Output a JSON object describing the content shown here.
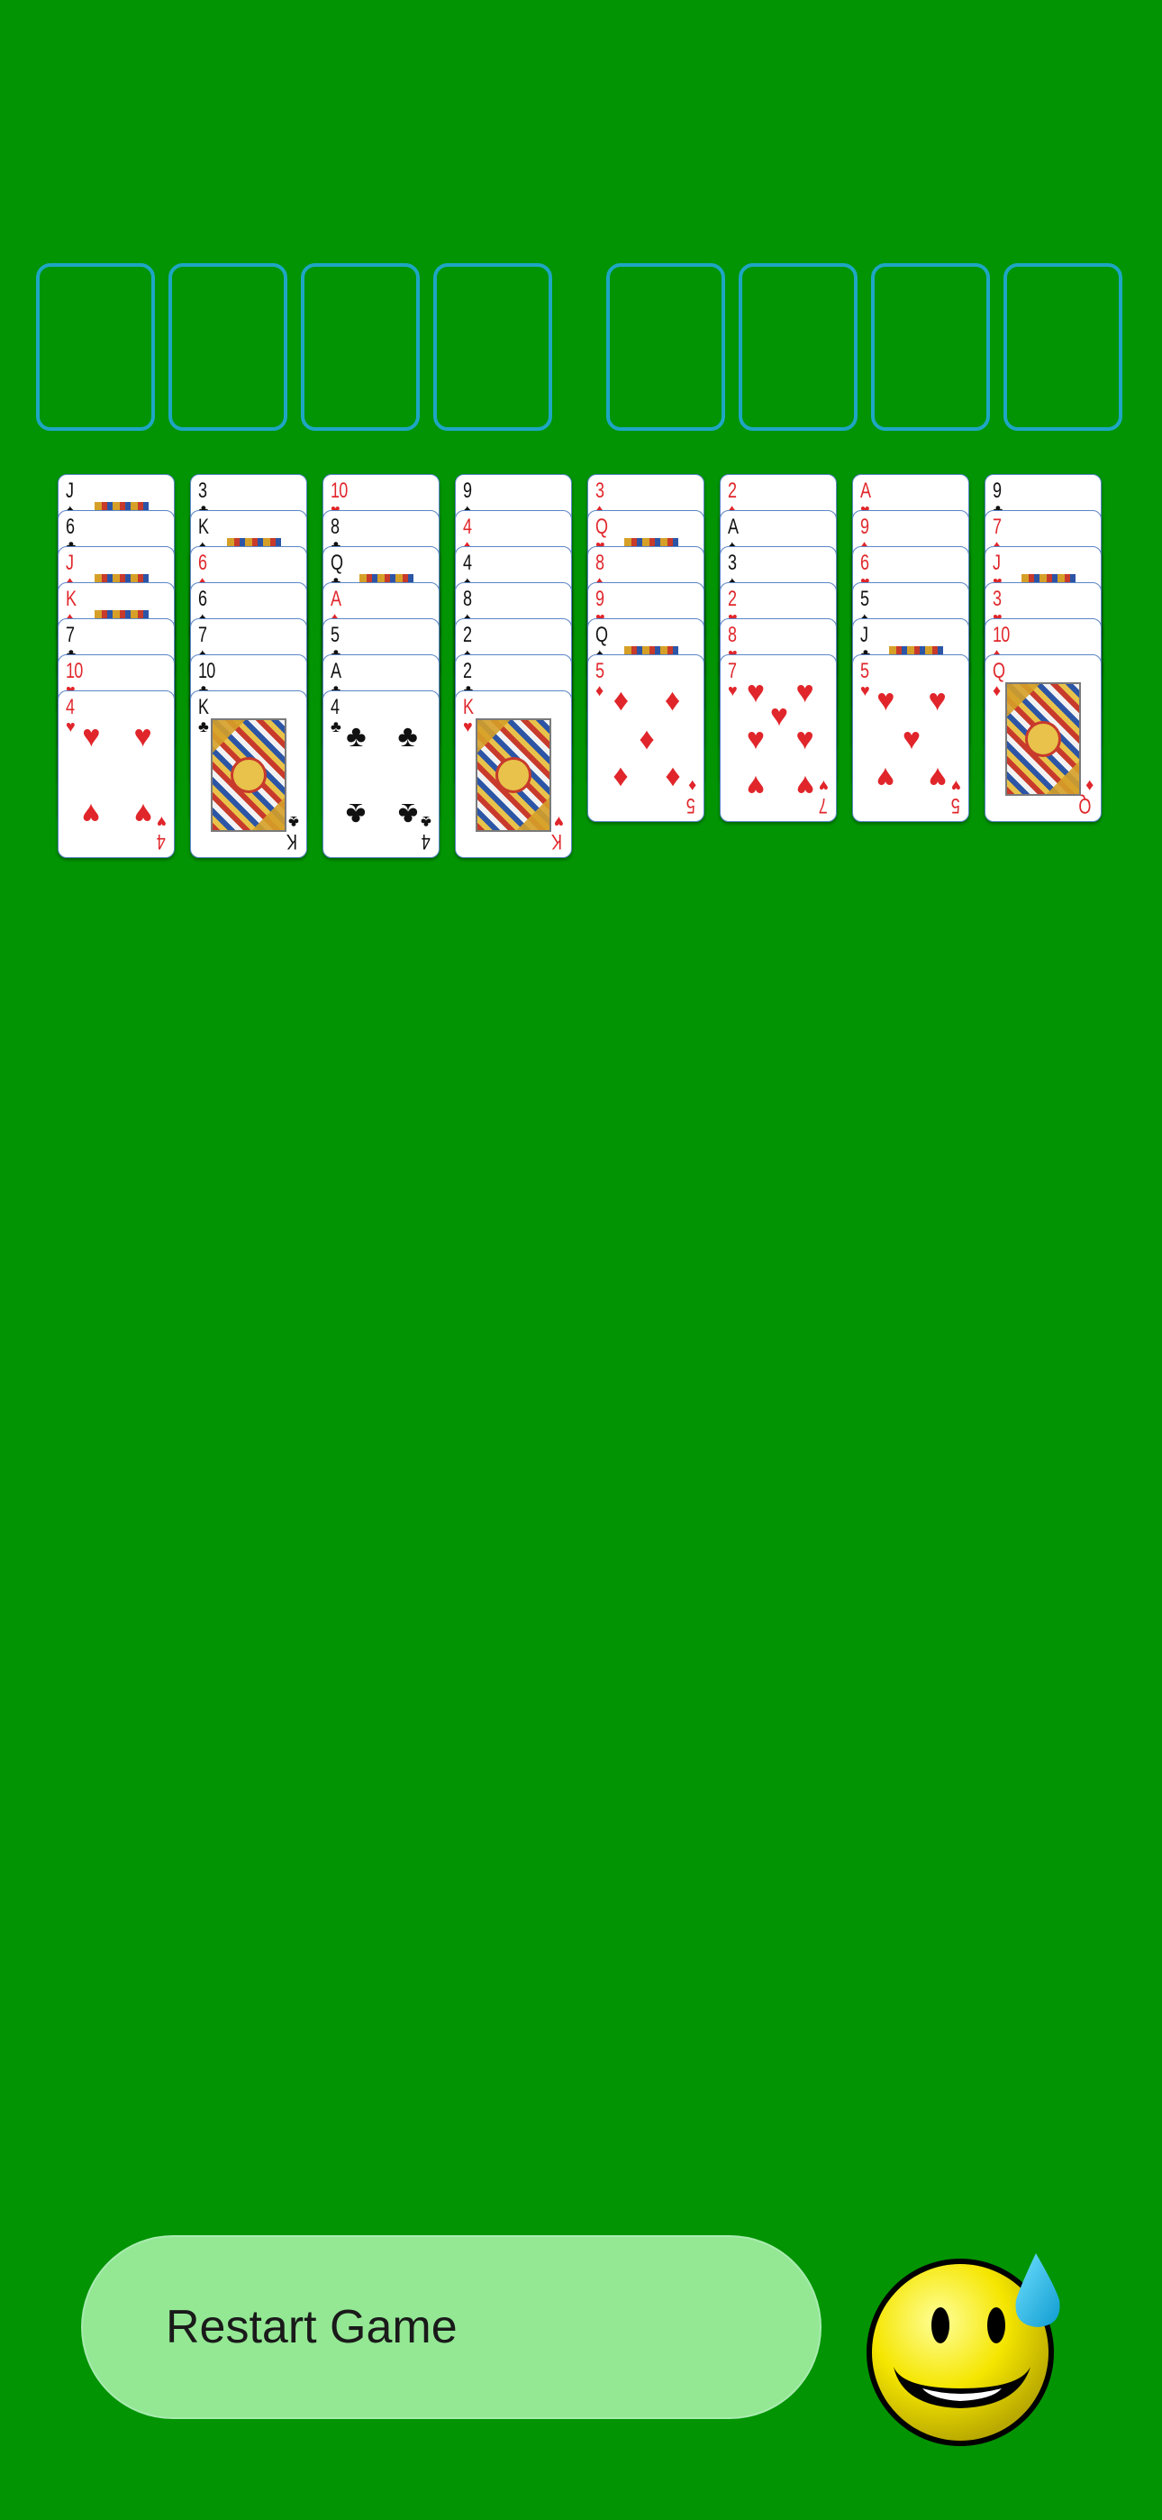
{
  "colors": {
    "felt": "#029402",
    "slot_outline": "#1ea6c4",
    "red_suit": "#e0262b",
    "black_suit": "#111111",
    "restart_fill": "#94e894"
  },
  "foundations": [
    "",
    "",
    "",
    ""
  ],
  "free_cells": [
    "",
    "",
    "",
    ""
  ],
  "tableau": [
    [
      {
        "rank": "J",
        "suit": "♠",
        "color": "black"
      },
      {
        "rank": "6",
        "suit": "♣",
        "color": "black"
      },
      {
        "rank": "J",
        "suit": "♦",
        "color": "red"
      },
      {
        "rank": "K",
        "suit": "♦",
        "color": "red"
      },
      {
        "rank": "7",
        "suit": "♣",
        "color": "black"
      },
      {
        "rank": "10",
        "suit": "♥",
        "color": "red"
      },
      {
        "rank": "4",
        "suit": "♥",
        "color": "red"
      }
    ],
    [
      {
        "rank": "3",
        "suit": "♣",
        "color": "black"
      },
      {
        "rank": "K",
        "suit": "♠",
        "color": "black"
      },
      {
        "rank": "6",
        "suit": "♦",
        "color": "red"
      },
      {
        "rank": "6",
        "suit": "♠",
        "color": "black"
      },
      {
        "rank": "7",
        "suit": "♠",
        "color": "black"
      },
      {
        "rank": "10",
        "suit": "♣",
        "color": "black"
      },
      {
        "rank": "K",
        "suit": "♣",
        "color": "black"
      }
    ],
    [
      {
        "rank": "10",
        "suit": "♥",
        "color": "red"
      },
      {
        "rank": "8",
        "suit": "♣",
        "color": "black"
      },
      {
        "rank": "Q",
        "suit": "♣",
        "color": "black"
      },
      {
        "rank": "A",
        "suit": "♦",
        "color": "red"
      },
      {
        "rank": "5",
        "suit": "♣",
        "color": "black"
      },
      {
        "rank": "A",
        "suit": "♣",
        "color": "black"
      },
      {
        "rank": "4",
        "suit": "♣",
        "color": "black"
      }
    ],
    [
      {
        "rank": "9",
        "suit": "♠",
        "color": "black"
      },
      {
        "rank": "4",
        "suit": "♦",
        "color": "red"
      },
      {
        "rank": "4",
        "suit": "♠",
        "color": "black"
      },
      {
        "rank": "8",
        "suit": "♠",
        "color": "black"
      },
      {
        "rank": "2",
        "suit": "♠",
        "color": "black"
      },
      {
        "rank": "2",
        "suit": "♣",
        "color": "black"
      },
      {
        "rank": "K",
        "suit": "♥",
        "color": "red"
      }
    ],
    [
      {
        "rank": "3",
        "suit": "♦",
        "color": "red"
      },
      {
        "rank": "Q",
        "suit": "♥",
        "color": "red"
      },
      {
        "rank": "8",
        "suit": "♦",
        "color": "red"
      },
      {
        "rank": "9",
        "suit": "♥",
        "color": "red"
      },
      {
        "rank": "Q",
        "suit": "♠",
        "color": "black"
      },
      {
        "rank": "5",
        "suit": "♦",
        "color": "red"
      }
    ],
    [
      {
        "rank": "2",
        "suit": "♦",
        "color": "red"
      },
      {
        "rank": "A",
        "suit": "♠",
        "color": "black"
      },
      {
        "rank": "3",
        "suit": "♠",
        "color": "black"
      },
      {
        "rank": "2",
        "suit": "♥",
        "color": "red"
      },
      {
        "rank": "8",
        "suit": "♥",
        "color": "red"
      },
      {
        "rank": "7",
        "suit": "♥",
        "color": "red"
      }
    ],
    [
      {
        "rank": "A",
        "suit": "♥",
        "color": "red"
      },
      {
        "rank": "9",
        "suit": "♦",
        "color": "red"
      },
      {
        "rank": "6",
        "suit": "♥",
        "color": "red"
      },
      {
        "rank": "5",
        "suit": "♠",
        "color": "black"
      },
      {
        "rank": "J",
        "suit": "♣",
        "color": "black"
      },
      {
        "rank": "5",
        "suit": "♥",
        "color": "red"
      }
    ],
    [
      {
        "rank": "9",
        "suit": "♣",
        "color": "black"
      },
      {
        "rank": "7",
        "suit": "♦",
        "color": "red"
      },
      {
        "rank": "J",
        "suit": "♥",
        "color": "red"
      },
      {
        "rank": "3",
        "suit": "♥",
        "color": "red"
      },
      {
        "rank": "10",
        "suit": "♦",
        "color": "red"
      },
      {
        "rank": "Q",
        "suit": "♦",
        "color": "red"
      }
    ]
  ],
  "restart_button": {
    "label": "Restart Game"
  },
  "status_emoji": {
    "icon": "nervous-sweat-smiley-icon"
  }
}
